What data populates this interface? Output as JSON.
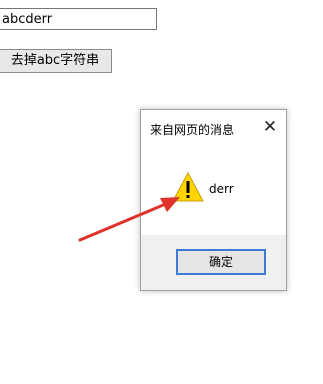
{
  "input": {
    "value": "abcderr"
  },
  "action_button": {
    "label": "去掉abc字符串"
  },
  "dialog": {
    "title": "来自网页的消息",
    "close_glyph": "✕",
    "message": "derr",
    "ok_label": "确定",
    "icon": "warning-icon"
  },
  "colors": {
    "dialog_ok_border": "#3a7bd5",
    "warning_fill": "#ffd400",
    "annotation_arrow": "#e0312b"
  }
}
